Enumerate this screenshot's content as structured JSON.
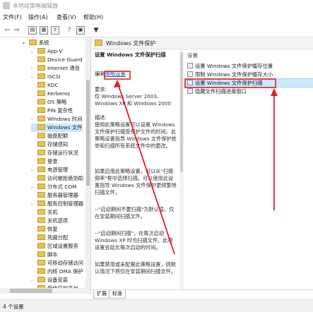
{
  "window": {
    "title": "本地组策略编辑器"
  },
  "menu": [
    "文件(F)",
    "操作(A)",
    "查看(V)",
    "帮助(H)"
  ],
  "tree": [
    {
      "label": "系统",
      "depth": 0,
      "chev": "▾"
    },
    {
      "label": "App-V",
      "depth": 1,
      "chev": "›"
    },
    {
      "label": "Device Guard",
      "depth": 1,
      "chev": ""
    },
    {
      "label": "Internet 通信",
      "depth": 1,
      "chev": "›"
    },
    {
      "label": "iSCSI",
      "depth": 1,
      "chev": "›"
    },
    {
      "label": "KDC",
      "depth": 1,
      "chev": ""
    },
    {
      "label": "Kerberos",
      "depth": 1,
      "chev": ""
    },
    {
      "label": "OS 策略",
      "depth": 1,
      "chev": ""
    },
    {
      "label": "PIN 复杂性",
      "depth": 1,
      "chev": ""
    },
    {
      "label": "Windows 时间",
      "depth": 1,
      "chev": "›"
    },
    {
      "label": "Windows 文件",
      "depth": 1,
      "chev": "",
      "selected": true
    },
    {
      "label": "磁盘配额",
      "depth": 1,
      "chev": ""
    },
    {
      "label": "存储感知",
      "depth": 1,
      "chev": ""
    },
    {
      "label": "存储运行状况",
      "depth": 1,
      "chev": ""
    },
    {
      "label": "登录",
      "depth": 1,
      "chev": ""
    },
    {
      "label": "电源管理",
      "depth": 1,
      "chev": "›"
    },
    {
      "label": "访问被拒绝协助",
      "depth": 1,
      "chev": ""
    },
    {
      "label": "分布式 COM",
      "depth": 1,
      "chev": "›"
    },
    {
      "label": "服务器管理器",
      "depth": 1,
      "chev": ""
    },
    {
      "label": "服务控制管理器",
      "depth": 1,
      "chev": "›"
    },
    {
      "label": "关机",
      "depth": 1,
      "chev": ""
    },
    {
      "label": "关机选项",
      "depth": 1,
      "chev": ""
    },
    {
      "label": "恢复",
      "depth": 1,
      "chev": ""
    },
    {
      "label": "凭据分配",
      "depth": 1,
      "chev": ""
    },
    {
      "label": "区域设置服务",
      "depth": 1,
      "chev": ""
    },
    {
      "label": "脚本",
      "depth": 1,
      "chev": ""
    },
    {
      "label": "可移动存储访问",
      "depth": 1,
      "chev": ""
    },
    {
      "label": "内核 DMA 保护",
      "depth": 1,
      "chev": ""
    },
    {
      "label": "设备安装",
      "depth": 1,
      "chev": "›"
    },
    {
      "label": "受信任的平台",
      "depth": 1,
      "chev": ""
    }
  ],
  "header": {
    "title": "Windows 文件保护"
  },
  "description": {
    "title": "设置 Windows 文件保护扫描",
    "edit_prefix": "编辑",
    "edit_link": "策略设置",
    "para1": "要求:\n仅 Windows Server 2003、Windows XP 和 Windows 2000",
    "para2": "描述:\n使用此策略设置可以设置 Windows 文件保护扫描受保护文件的时间。此策略设置指导 Windows 文件保护枚举和扫描所有系统文件中的更改。",
    "para3": "如果启用此策略设置，可以从\"扫描频率\"框中选择扫描。可以使用此设置指导 Windows 文件保护更频繁地扫描文件。",
    "para4": "--\"启动期间不要扫描\"为默认值，仅在安装期间扫描文件。",
    "para5": "--\"启动期间扫描\"，在每次启动 Windows XP 时也扫描文件。此项设置会延长每次启动的时间。",
    "para6": "如果禁用或未配置此策略设置，则默认情况下将仅在安装期间扫描文件。"
  },
  "list": {
    "header": "设置",
    "items": [
      {
        "label": "设置 Windows 文件保护缓存位置",
        "selected": false
      },
      {
        "label": "限制 Windows 文件保护缓存大小",
        "selected": false
      },
      {
        "label": "设置 Windows 文件保护扫描",
        "selected": true
      },
      {
        "label": "隐藏文件扫描进度窗口",
        "selected": false
      }
    ]
  },
  "tabs": [
    "扩展",
    "标准"
  ],
  "status": {
    "text": "4 个设置"
  },
  "colors": {
    "accent": "#0b5cc5",
    "annotation": "#e02020",
    "selection": "#cce8ff"
  }
}
